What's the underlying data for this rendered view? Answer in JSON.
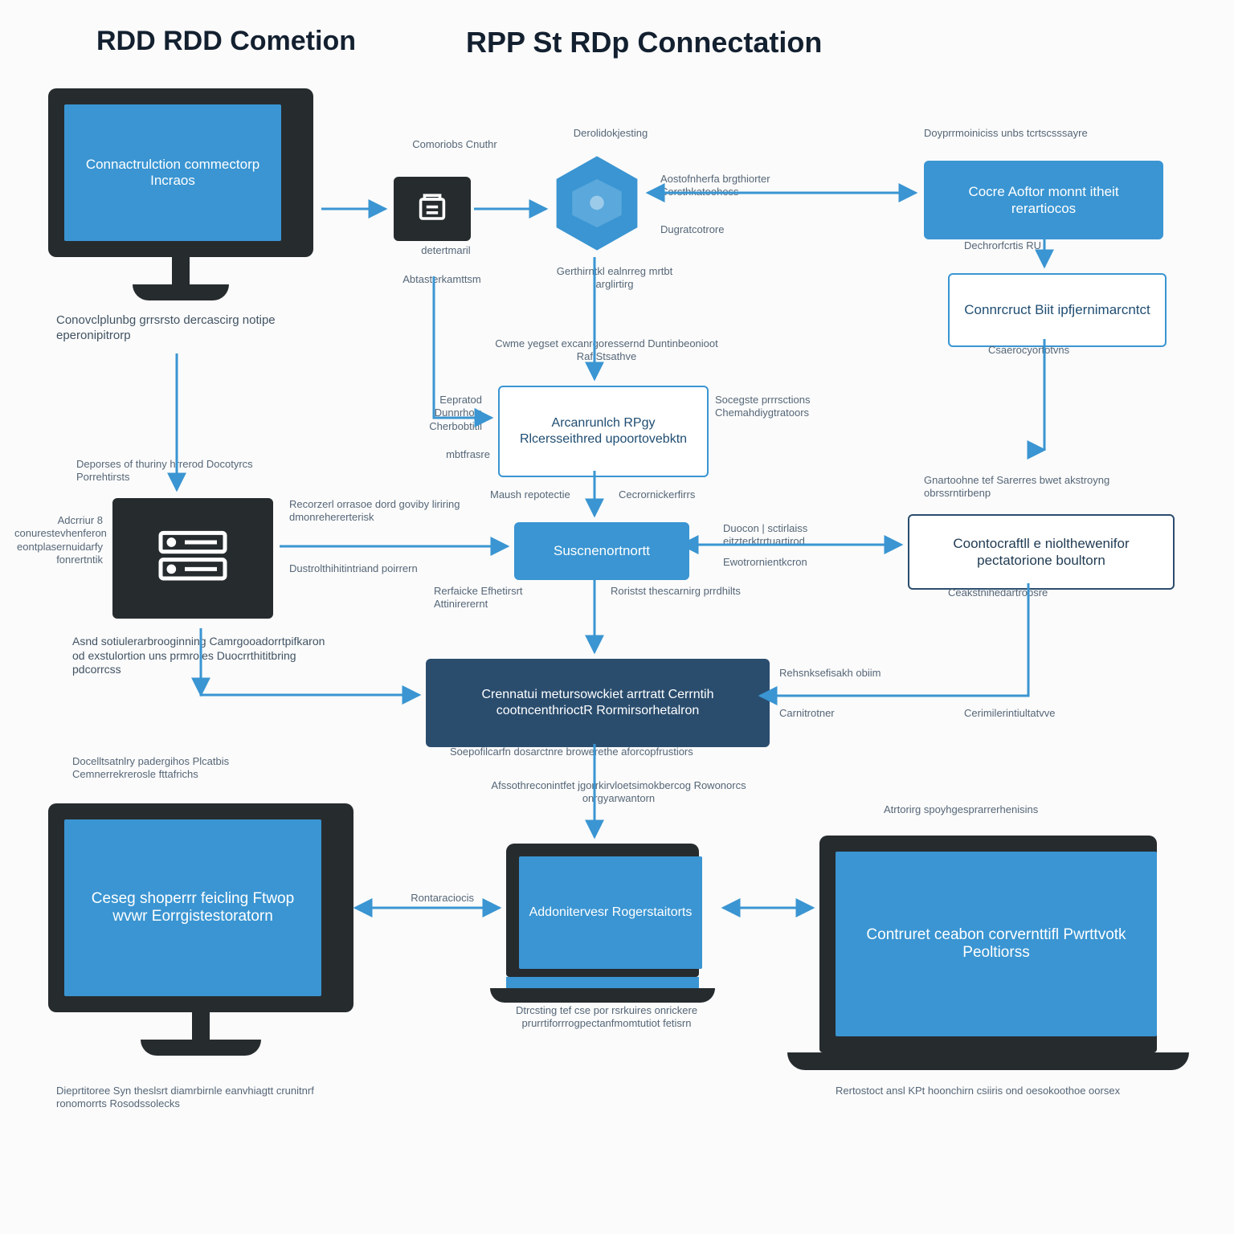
{
  "titles": {
    "left": "RDD RDD Cometion",
    "right": "RPP St RDp Connectation"
  },
  "monitor_top": {
    "screen": "Connactrulction commectorp Incraos",
    "caption": "Conovclplunbg grrsrsto dercascirg notipe eperonipitrorp"
  },
  "tile_doc": {
    "top": "Comoriobs Cnuthr",
    "bottom": "detertmaril",
    "below": "Abtasterkamttsm"
  },
  "hex": {
    "top": "Derolidokjesting",
    "right": "Aostofnherfa brgthiorter Corsthkatoohess",
    "rb": "Dugratcotrore",
    "below": "Gerthirntkl ealnrreg mrtbt arglirtirg"
  },
  "top_right": {
    "top_caption": "Doyprrmoiniciss unbs tcrtscsssayre",
    "box1": "Cocre Aoftor monnt itheit rerartiocos",
    "between": "Dechrorfcrtis RU",
    "box2": "Connrcruct Biit ipfjernimarcntct",
    "below": "Csaerocyortotvns"
  },
  "mid_center": {
    "above": "Cwme yegset excanrgoressernd Duntinbeonioot Raf Stsathve",
    "box": "Arcanrunlch RPgy Rlcersseithred upoortovebktn",
    "left_top": "Eepratod Dunnrhois Cherbobtitil",
    "left_bot": "mbtfrasre",
    "right": "Socegste prrrsctions Chemahdiygtratoors"
  },
  "sub_center": {
    "left": "Maush repotectie",
    "right": "Cecrornickerfirrs",
    "box": "Suscnenortnortt",
    "arrow_right_top": "Duocon | sctirlaiss eitzterktrrtuartirod",
    "arrow_right_bot": "Ewotrornientkcron",
    "below_left": "Rerfaicke Efhetirsrt Attinirerernt",
    "below_right": "Roristst thescarnirg prrdhilts"
  },
  "far_right_mid": {
    "above": "Gnartoohne tef Sarerres bwet akstroyng obrssrntirbenp",
    "box": "Coontocraftll e niolthewenifor pectatorione boultorn",
    "below": "Ceakstnihedartrobsre"
  },
  "tile_server": {
    "left_caption": "Adcrriur 8 conurestevhenferon eontplasernuidarfy fonrertntik",
    "right_top": "Recorzerl orrasoe dord goviby liriring dmonrehererterisk",
    "right_bot": "Dustrolthihitintriand poirrern",
    "below": "Asnd sotiulerarbrooginning Camrgooadorrtpifkaron od exstulortion uns prmroies Duocrrthititbring pdcorrcss"
  },
  "navy_center": {
    "box": "Crennatui metursowckiet arrtratt Cerrntih cootncenthrioctR Rormirsorhetalron",
    "below": "Soepofilcarfn dosarctnre browerethe aforcopfrustiors",
    "right_top": "Rehsnksefisakh obiim",
    "right_bot": "Carnitrotner",
    "far_right": "Cerimilerintiultatvve"
  },
  "bottom_left_monitor": {
    "above": "Docelltsatnlry padergihos Plcatbis Cemnerrekrerosle fttafrichs",
    "screen": "Ceseg shoperrr feicling Ftwop wvwr Eorrgistestoratorn",
    "caption": "Dieprtitoree Syn theslsrt diamrbirnle eanvhiagtt crunitnrf ronomorrts Rosodssolecks"
  },
  "bottom_mid": {
    "above": "Afssothreconintfet jgorrkirvloetsimokbercog Rowonorcs onrgyarwantorn",
    "box": "Addonitervesr Rogerstaitorts",
    "arrow_label": "Rontaraciocis",
    "below": "Dtrcsting tef cse por rsrkuires onrickere prurrtiforrrogpectanfmomtutiot fetisrn"
  },
  "bottom_right_laptop": {
    "above": "Atrtorirg spoyhgesprarrerhenisins",
    "screen": "Contruret ceabon corvernttifl Pwrttvotk Peoltiorss",
    "caption": "Rertostoct ansl KPt hoonchirn csiiris ond oesokoothoe oorsex"
  },
  "down_label": "Deporses of thuriny hrrerod Docotyrcs Porrehtirsts"
}
